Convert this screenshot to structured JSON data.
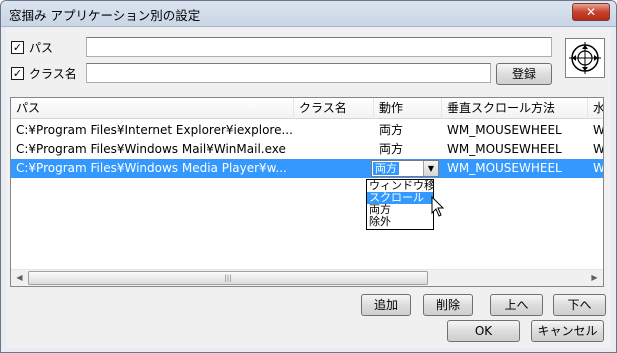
{
  "window": {
    "title": "窓掴み アプリケーション別の設定",
    "close_label": "✕"
  },
  "filters": {
    "path": {
      "checked": true,
      "label": "パス",
      "value": ""
    },
    "class": {
      "checked": true,
      "label": "クラス名",
      "value": ""
    },
    "register_label": "登録"
  },
  "list": {
    "columns": [
      "パス",
      "クラス名",
      "動作",
      "垂直スクロール方法",
      "水"
    ],
    "rows": [
      {
        "path": "C:¥Program Files¥Internet Explorer¥iexplore....",
        "class": "",
        "action": "両方",
        "vscroll": "WM_MOUSEWHEEL",
        "h": "W"
      },
      {
        "path": "C:¥Program Files¥Windows Mail¥WinMail.exe",
        "class": "",
        "action": "両方",
        "vscroll": "WM_MOUSEWHEEL",
        "h": "W"
      },
      {
        "path": "C:¥Program Files¥Windows Media Player¥w...",
        "class": "",
        "action": "両方",
        "vscroll": "WM_MOUSEWHEEL",
        "h": "W"
      }
    ],
    "combo_value": "両方",
    "dropdown_options": [
      "ウィンドウ移動",
      "スクロール",
      "両方",
      "除外"
    ],
    "dropdown_highlighted": 1
  },
  "buttons": {
    "add": "追加",
    "delete": "削除",
    "up": "上へ",
    "down": "下へ",
    "ok": "OK",
    "cancel": "キャンセル"
  },
  "colors": {
    "selection": "#3399ff",
    "titlebar": "#c9d6e6",
    "close": "#c8412c"
  },
  "icons": {
    "scroll_left": "left-arrow-icon",
    "scroll_right": "right-arrow-icon",
    "grip": "scroll-grip-icon",
    "app": "target-crosshair-icon"
  }
}
